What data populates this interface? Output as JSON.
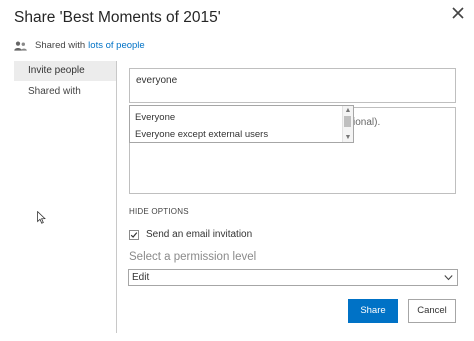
{
  "dialog": {
    "title": "Share 'Best Moments of 2015'",
    "shared_prefix": "Shared with",
    "shared_link": "lots of people"
  },
  "nav": {
    "items": [
      {
        "label": "Invite people",
        "active": true
      },
      {
        "label": "Shared with",
        "active": false
      }
    ]
  },
  "invite": {
    "value": "everyone",
    "suggestions": [
      "Everyone",
      "Everyone except external users"
    ],
    "message_hint": "ional)."
  },
  "options": {
    "hide_label": "HIDE OPTIONS",
    "email_checkbox_label": "Send an email invitation",
    "email_checked": true,
    "permission_label": "Select a permission level",
    "permission_value": "Edit"
  },
  "buttons": {
    "share": "Share",
    "cancel": "Cancel"
  },
  "colors": {
    "accent": "#0072c6",
    "link": "#0072c6"
  },
  "icons": [
    "close-icon",
    "people-icon",
    "checkmark-icon",
    "chevron-down-icon",
    "mouse-cursor"
  ]
}
